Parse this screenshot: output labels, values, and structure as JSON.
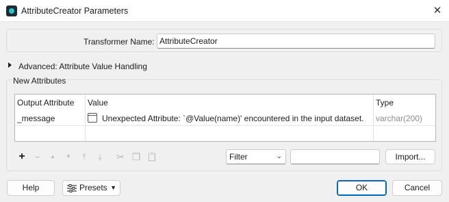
{
  "window": {
    "title": "AttributeCreator Parameters",
    "close_glyph": "✕"
  },
  "transformer": {
    "label": "Transformer Name:",
    "value": "AttributeCreator"
  },
  "advanced": {
    "label": "Advanced: Attribute Value Handling"
  },
  "new_attributes": {
    "group_title": "New Attributes",
    "columns": [
      "Output Attribute",
      "Value",
      "Type"
    ],
    "rows": [
      {
        "output_attribute": "_message",
        "value": "Unexpected Attribute: `@Value(name)' encountered in the input dataset.",
        "type": "varchar(200)"
      }
    ]
  },
  "toolbar": {
    "add": "+",
    "remove": "−",
    "move_up": "▲",
    "move_down": "▼",
    "move_top": "⤒",
    "move_bottom": "⤓",
    "cut": "✂",
    "copy": "❐",
    "paste": "📋"
  },
  "filter": {
    "selected": "Filter",
    "caret": "⌄",
    "input_value": ""
  },
  "buttons": {
    "import": "Import...",
    "help": "Help",
    "presets": "Presets",
    "presets_caret": "▼",
    "ok": "OK",
    "cancel": "Cancel"
  },
  "colors": {
    "accent": "#0067c0",
    "app_icon_teal": "#27c3c8",
    "type_text": "#8c8c8c"
  }
}
